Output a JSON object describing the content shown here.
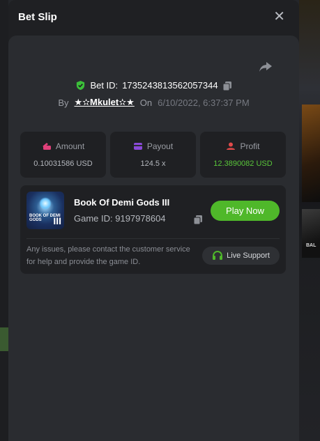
{
  "header": {
    "title": "Bet Slip"
  },
  "bet": {
    "id_label": "Bet ID:",
    "id_value": "1735243813562057344",
    "by_label": "By",
    "user": "★✫Mkulet✫★",
    "on_label": "On",
    "datetime": "6/10/2022, 6:37:37 PM"
  },
  "stats": {
    "amount_label": "Amount",
    "amount_value": "0.10031586 USD",
    "payout_label": "Payout",
    "payout_value": "124.5 x",
    "profit_label": "Profit",
    "profit_value": "12.3890082 USD"
  },
  "game": {
    "name": "Book Of Demi Gods III",
    "id_text": "Game ID: 9197978604",
    "thumb_text": "BOOK OF DEMI GODS",
    "thumb_numeral": "III",
    "play_label": "Play Now",
    "notice": "Any issues, please contact the customer service for help and provide the game ID.",
    "support_label": "Live Support"
  },
  "colors": {
    "accent_green": "#4fb82a",
    "profit_green": "#59c53a",
    "amount_pink": "#e0407a",
    "payout_purple": "#8a4ad8",
    "profit_red": "#e04a4a"
  },
  "icons": [
    "close-icon",
    "share-icon",
    "shield-check-icon",
    "copy-icon",
    "wallet-icon",
    "card-icon",
    "user-profit-icon",
    "headset-icon"
  ]
}
